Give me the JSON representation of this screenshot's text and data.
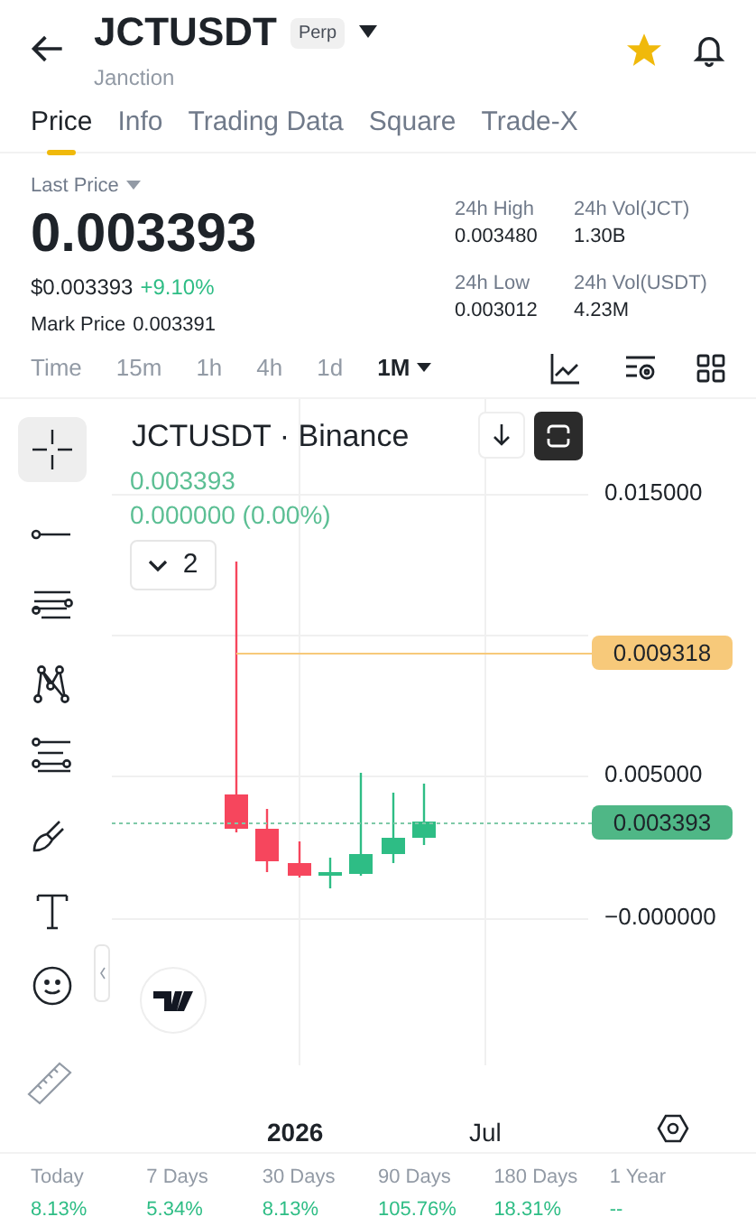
{
  "header": {
    "symbol": "JCTUSDT",
    "badge": "Perp",
    "subtitle": "Janction",
    "favorite": true
  },
  "tabs": [
    {
      "label": "Price",
      "selected": true
    },
    {
      "label": "Info",
      "selected": false
    },
    {
      "label": "Trading Data",
      "selected": false
    },
    {
      "label": "Square",
      "selected": false
    },
    {
      "label": "Trade-X",
      "selected": false
    }
  ],
  "price": {
    "label": "Last Price",
    "value": "0.003393",
    "usd": "$0.003393",
    "change": "+9.10%",
    "mark_label": "Mark Price",
    "mark_value": "0.003391"
  },
  "stats": [
    {
      "label": "24h High",
      "value": "0.003480"
    },
    {
      "label": "24h Vol(JCT)",
      "value": "1.30B"
    },
    {
      "label": "24h Low",
      "value": "0.003012"
    },
    {
      "label": "24h Vol(USDT)",
      "value": "4.23M"
    }
  ],
  "intervals": [
    {
      "label": "Time",
      "selected": false
    },
    {
      "label": "15m",
      "selected": false
    },
    {
      "label": "1h",
      "selected": false
    },
    {
      "label": "4h",
      "selected": false
    },
    {
      "label": "1d",
      "selected": false
    },
    {
      "label": "1M",
      "selected": true
    }
  ],
  "chart": {
    "title": "JCTUSDT · Binance",
    "legend_price": "0.003393",
    "legend_change": "0.000000 (0.00%)",
    "indicator_count": "2",
    "y_labels": [
      "0.015000",
      "0.005000",
      "−0.000000"
    ],
    "high_tag": "0.009318",
    "price_tag": "0.003393",
    "x_labels": [
      "2026",
      "Jul"
    ]
  },
  "performance": [
    {
      "label": "Today",
      "value": "8.13%"
    },
    {
      "label": "7 Days",
      "value": "5.34%"
    },
    {
      "label": "30 Days",
      "value": "8.13%"
    },
    {
      "label": "90 Days",
      "value": "105.76%"
    },
    {
      "label": "180 Days",
      "value": "18.31%"
    },
    {
      "label": "1 Year",
      "value": "--"
    }
  ]
}
